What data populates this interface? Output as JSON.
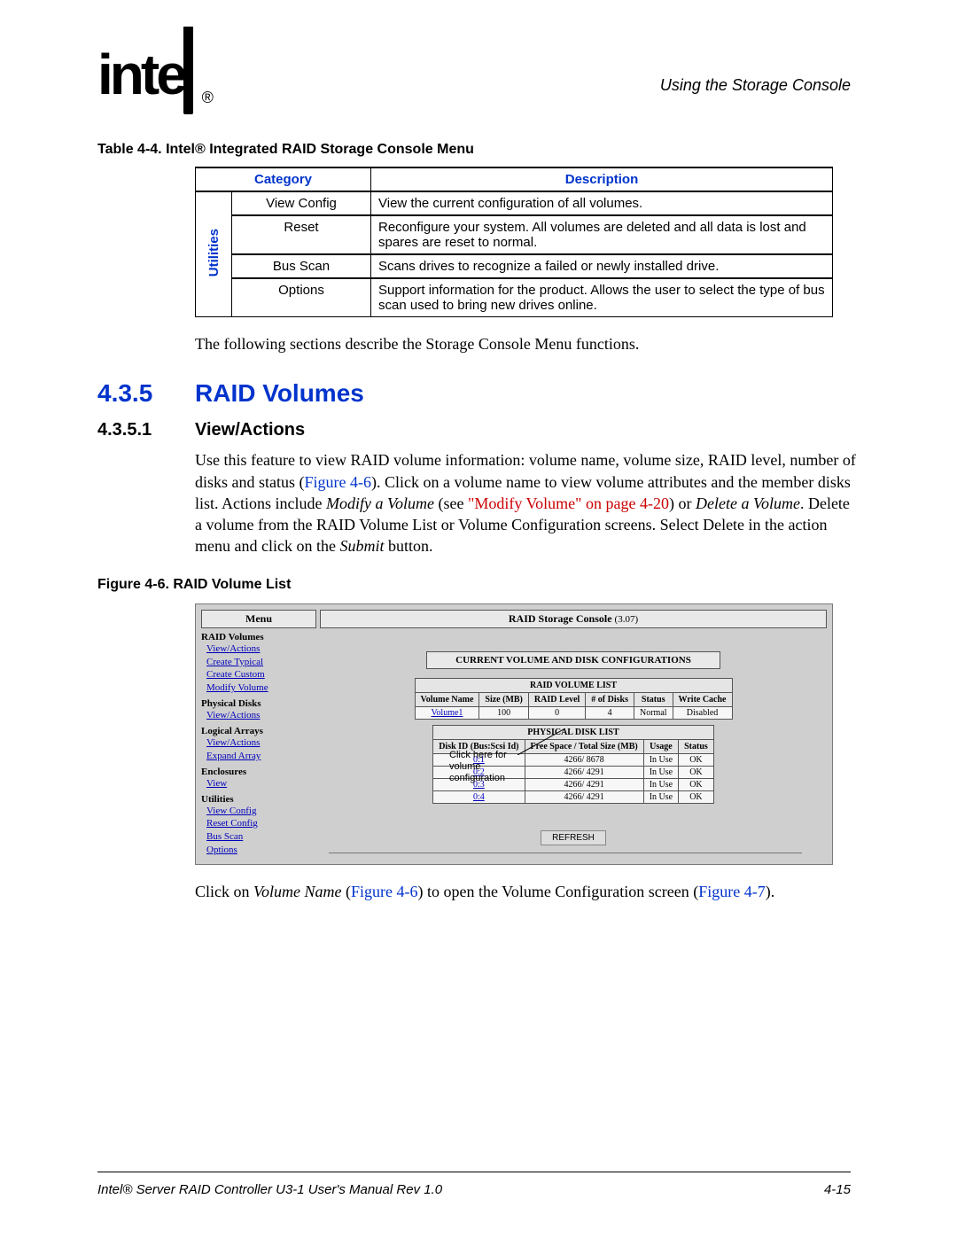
{
  "header_right": "Using the Storage Console",
  "logo": {
    "text": "intel",
    "reg": "®"
  },
  "table_caption": "Table 4-4. Intel® Integrated RAID Storage Console Menu",
  "table": {
    "head_category": "Category",
    "head_description": "Description",
    "side_label": "Utilities",
    "rows": [
      {
        "item": "View Config",
        "desc": "View the current configuration of all volumes."
      },
      {
        "item": "Reset",
        "desc": "Reconfigure your system. All volumes are deleted and all data is lost and spares are reset to normal."
      },
      {
        "item": "Bus Scan",
        "desc": "Scans drives to recognize a failed or newly installed drive."
      },
      {
        "item": "Options",
        "desc": "Support information for the product. Allows the user to select the type of bus scan used to bring new drives online."
      }
    ]
  },
  "para_after_table": "The following sections describe the Storage Console Menu functions.",
  "h2": {
    "num": "4.3.5",
    "text": "RAID Volumes"
  },
  "h3": {
    "num": "4.3.5.1",
    "text": "View/Actions"
  },
  "para_view": {
    "t1": "Use this feature to view RAID volume information: volume name, volume size, RAID level, number of disks and status (",
    "fig_ref_1": "Figure 4-6",
    "t2": "). Click on a volume name to view volume attributes and the member disks list. Actions include ",
    "emph1": "Modify a Volume",
    "t3": " (see ",
    "link_modify": "\"Modify Volume\" on page 4-20",
    "t4": ") or ",
    "emph2": "Delete a Volume",
    "t5": ". Delete a volume from the RAID Volume List or Volume Configuration screens. Select Delete in the action menu and click on the ",
    "emph3": "Submit",
    "t6": " button."
  },
  "fig_caption": "Figure 4-6. RAID Volume List",
  "screenshot": {
    "menu_title": "Menu",
    "sections": [
      {
        "head": "RAID Volumes",
        "items": [
          "View/Actions",
          "Create Typical",
          "Create Custom",
          "Modify Volume"
        ]
      },
      {
        "head": "Physical Disks",
        "items": [
          "View/Actions"
        ]
      },
      {
        "head": "Logical Arrays",
        "items": [
          "View/Actions",
          "Expand Array"
        ]
      },
      {
        "head": "Enclosures",
        "items": [
          "View"
        ]
      },
      {
        "head": "Utilities",
        "items": [
          "View Config",
          "Reset Config",
          "Bus Scan",
          "Options"
        ]
      }
    ],
    "console_title": "RAID Storage Console",
    "console_version": "(3.07)",
    "config_band": "CURRENT VOLUME AND DISK CONFIGURATIONS",
    "callout": "Click here for volume configuration",
    "vol_table": {
      "title": "RAID VOLUME LIST",
      "headers": [
        "Volume Name",
        "Size (MB)",
        "RAID Level",
        "# of Disks",
        "Status",
        "Write Cache"
      ],
      "rows": [
        {
          "name": "Volume1",
          "cells": [
            "100",
            "0",
            "4",
            "Normal",
            "Disabled"
          ]
        }
      ]
    },
    "disk_table": {
      "title": "PHYSICAL DISK LIST",
      "headers": [
        "Disk ID (Bus:Scsi Id)",
        "Free Space / Total Size (MB)",
        "Usage",
        "Status"
      ],
      "rows": [
        {
          "id": "0:1",
          "cells": [
            "4266/ 8678",
            "In Use",
            "OK"
          ]
        },
        {
          "id": "0:2",
          "cells": [
            "4266/ 4291",
            "In Use",
            "OK"
          ]
        },
        {
          "id": "0:3",
          "cells": [
            "4266/ 4291",
            "In Use",
            "OK"
          ]
        },
        {
          "id": "0:4",
          "cells": [
            "4266/ 4291",
            "In Use",
            "OK"
          ]
        }
      ]
    },
    "refresh_label": "REFRESH"
  },
  "para_click": {
    "t1": "Click on ",
    "emph": "Volume Name",
    "t2": " (",
    "fig6": "Figure 4-6",
    "t3": ") to open the Volume Configuration screen (",
    "fig7": "Figure 4-7",
    "t4": ")."
  },
  "footer": {
    "left": "Intel® Server RAID Controller U3-1 User's Manual Rev 1.0",
    "right": "4-15"
  }
}
